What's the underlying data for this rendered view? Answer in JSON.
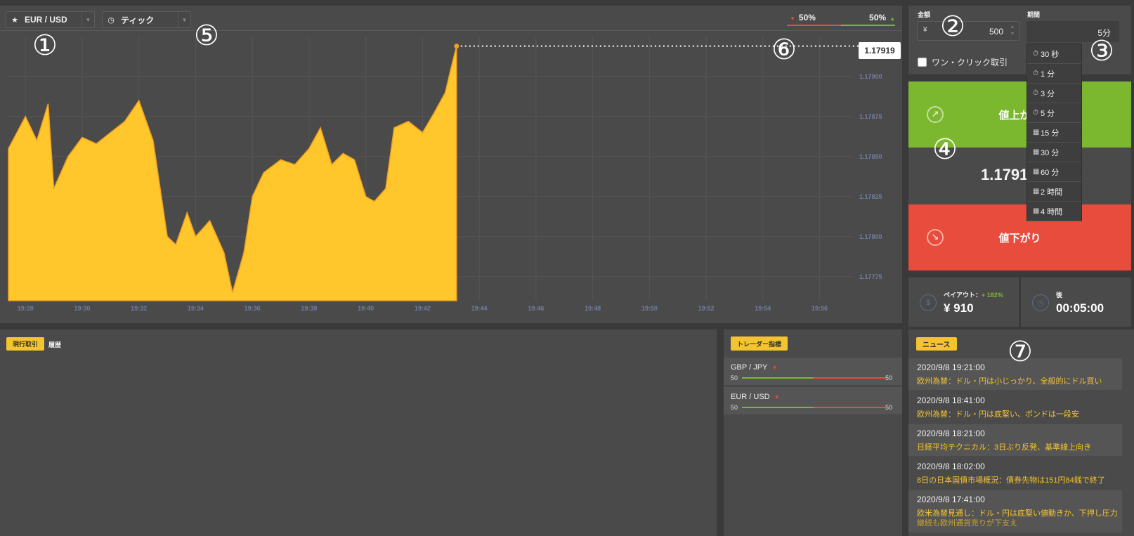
{
  "toolbar": {
    "pair_label": "EUR / USD",
    "chart_type_label": "ティック"
  },
  "sentiment": {
    "down_pct": "50%",
    "up_pct": "50%",
    "down_color": "#e74c3c",
    "up_color": "#7cb82f"
  },
  "chart": {
    "current_price": "1.17919",
    "area_color": "#ffc72c",
    "line_color": "#f0a020",
    "y_ticks": [
      "1.17900",
      "1.17875",
      "1.17850",
      "1.17825",
      "1.17800",
      "1.17775"
    ],
    "x_ticks": [
      "19:28",
      "19:30",
      "19:32",
      "19:34",
      "19:36",
      "19:38",
      "19:40",
      "19:42",
      "19:44",
      "19:46",
      "19:48",
      "19:50",
      "19:52",
      "19:54",
      "19:56"
    ]
  },
  "chart_data": {
    "type": "area",
    "title": "",
    "xlabel": "",
    "ylabel": "",
    "ylim": [
      1.1776,
      1.17925
    ],
    "x": [
      "19:27.4",
      "19:28",
      "19:28.4",
      "19:28.8",
      "19:29",
      "19:29.5",
      "19:30",
      "19:30.5",
      "19:31",
      "19:31.5",
      "19:32",
      "19:32.5",
      "19:33",
      "19:33.3",
      "19:33.7",
      "19:34",
      "19:34.5",
      "19:35",
      "19:35.3",
      "19:35.7",
      "19:36",
      "19:36.4",
      "19:37",
      "19:37.5",
      "19:38",
      "19:38.4",
      "19:38.8",
      "19:39.2",
      "19:39.6",
      "19:40",
      "19:40.3",
      "19:40.7",
      "19:41",
      "19:41.5",
      "19:42",
      "19:42.4",
      "19:42.8",
      "19:43",
      "19:43.2"
    ],
    "y": [
      1.17855,
      1.17875,
      1.1786,
      1.17883,
      1.1783,
      1.1785,
      1.17862,
      1.17858,
      1.17865,
      1.17872,
      1.17885,
      1.1786,
      1.178,
      1.17795,
      1.17815,
      1.178,
      1.1781,
      1.1779,
      1.17765,
      1.1779,
      1.17825,
      1.1784,
      1.17848,
      1.17845,
      1.17855,
      1.17868,
      1.17845,
      1.17852,
      1.17848,
      1.17825,
      1.17822,
      1.1783,
      1.17868,
      1.17872,
      1.17865,
      1.17877,
      1.1789,
      1.17905,
      1.17919
    ]
  },
  "trade": {
    "amount_label": "金額",
    "currency_symbol": "¥",
    "amount_value": "500",
    "period_label": "期間",
    "period_value": "5分",
    "one_click_label": "ワン・クリック取引",
    "up_label": "値上がり",
    "down_label": "値下がり",
    "current_rate": "1.17919",
    "payout_label": "ペイアウト：",
    "payout_pct": "+ 182%",
    "payout_value": "¥ 910",
    "remaining_label": "後",
    "remaining_value": "00:05:00"
  },
  "period_menu": [
    {
      "icon": "clock-icon",
      "glyph": "⏱",
      "label": "30 秒"
    },
    {
      "icon": "clock-icon",
      "glyph": "⏱",
      "label": "1 分"
    },
    {
      "icon": "clock-icon",
      "glyph": "⏱",
      "label": "3 分"
    },
    {
      "icon": "clock-icon",
      "glyph": "⏱",
      "label": "5 分"
    },
    {
      "icon": "calendar-icon",
      "glyph": "▦",
      "label": "15 分"
    },
    {
      "icon": "calendar-icon",
      "glyph": "▦",
      "label": "30 分"
    },
    {
      "icon": "calendar-icon",
      "glyph": "▦",
      "label": "60 分"
    },
    {
      "icon": "calendar-icon",
      "glyph": "▦",
      "label": "2 時間"
    },
    {
      "icon": "calendar-icon",
      "glyph": "▦",
      "label": "4 時間"
    }
  ],
  "positions": {
    "tab_current": "現行取引",
    "tab_history": "履歴"
  },
  "trader_indicator": {
    "title": "トレーダー指標",
    "pairs": [
      {
        "name": "GBP / JPY",
        "left": "50",
        "right": "50"
      },
      {
        "name": "EUR / USD",
        "left": "50",
        "right": "50"
      }
    ]
  },
  "news": {
    "title": "ニュース",
    "items": [
      {
        "date": "2020/9/8 19:21:00",
        "headline": "欧州為替：ドル・円は小じっかり、全般的にドル買い",
        "headline2": ""
      },
      {
        "date": "2020/9/8 18:41:00",
        "headline": "欧州為替：ドル・円は底堅い、ポンドは一段安",
        "headline2": ""
      },
      {
        "date": "2020/9/8 18:21:00",
        "headline": "日経平均テクニカル：3日ぶり反発、基準線上向き",
        "headline2": ""
      },
      {
        "date": "2020/9/8 18:02:00",
        "headline": "8日の日本国債市場概況：債券先物は151円84銭で終了",
        "headline2": ""
      },
      {
        "date": "2020/9/8 17:41:00",
        "headline": "欧米為替見通し：ドル・円は底堅い値動きか、下押し圧力",
        "headline2": "継続も欧州通貨売りが下支え"
      }
    ]
  },
  "markers": [
    "①",
    "②",
    "③",
    "④",
    "⑤",
    "⑥",
    "⑦"
  ]
}
